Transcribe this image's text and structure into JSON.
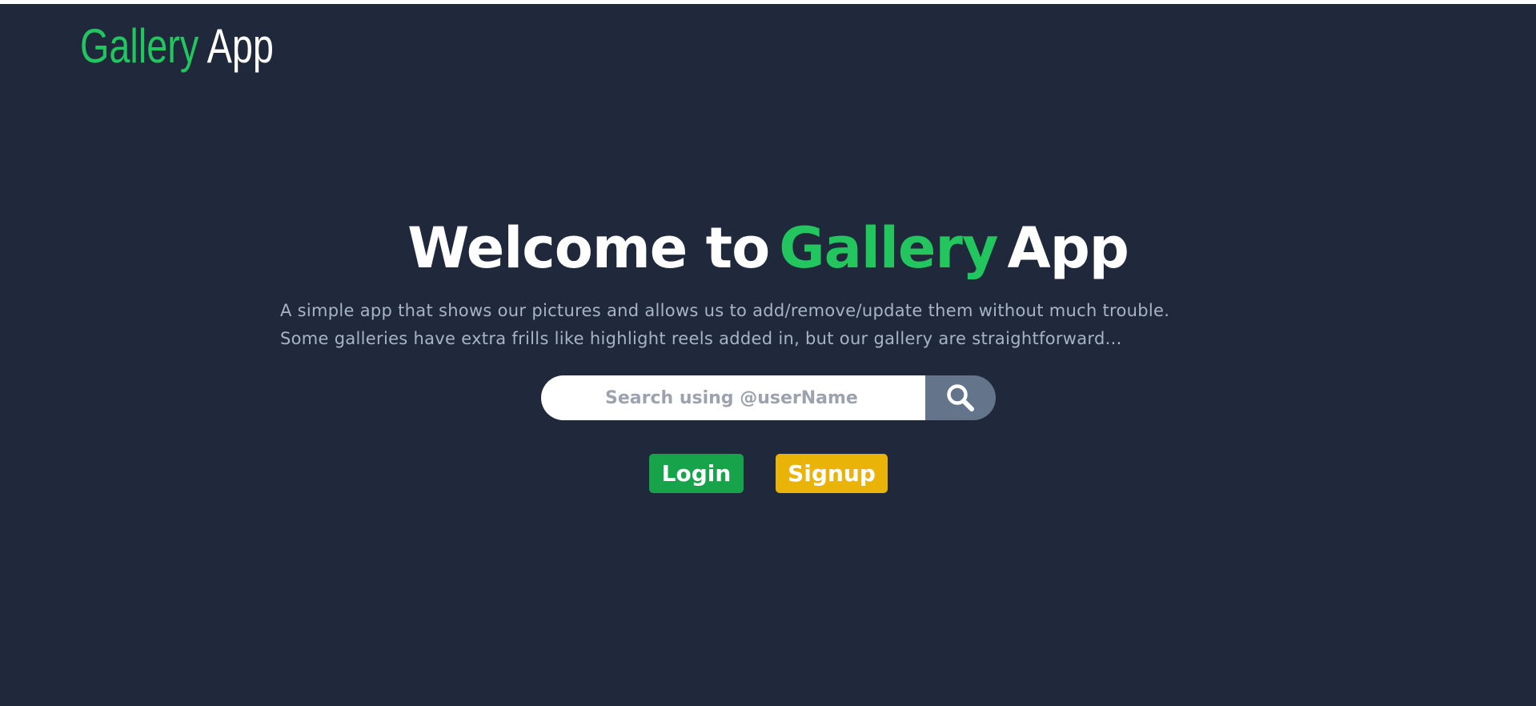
{
  "header": {
    "logo_part1": "Gallery",
    "logo_part2": "App"
  },
  "hero": {
    "title_part1": "Welcome to",
    "title_part2": "Gallery",
    "title_part3": "App",
    "description_line1": "A simple app that shows our pictures and allows us to add/remove/update them without much trouble.",
    "description_line2": "Some galleries have extra frills like highlight reels added in, but our gallery are straightforward..."
  },
  "search": {
    "placeholder": "Search using @userName",
    "value": "",
    "button_icon": "search-icon"
  },
  "actions": {
    "login_label": "Login",
    "signup_label": "Signup"
  },
  "colors": {
    "background": "#1f293b",
    "accent_green": "#22c55e",
    "login_green": "#16a34a",
    "signup_yellow": "#eab308",
    "search_button": "#64748b",
    "description_text": "#a7b3c7"
  }
}
